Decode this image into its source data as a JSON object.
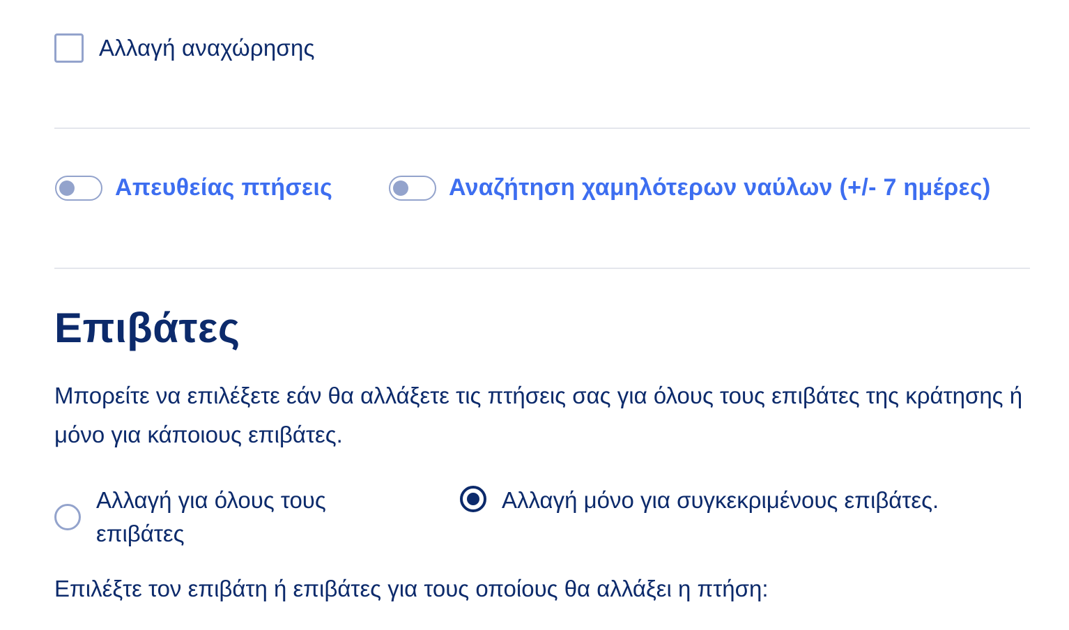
{
  "colors": {
    "primary": "#0c2a6b",
    "accent": "#3d6ef0",
    "muted": "#93a3cc",
    "divider": "#e4e6ec"
  },
  "departure_change": {
    "label": "Αλλαγή αναχώρησης",
    "checked": false
  },
  "toggles": [
    {
      "label": "Απευθείας πτήσεις",
      "on": false
    },
    {
      "label": "Αναζήτηση χαμηλότερων ναύλων (+/- 7 ημέρες)",
      "on": false
    }
  ],
  "passengers": {
    "title": "Επιβάτες",
    "description": "Μπορείτε να επιλέξετε εάν θα αλλάξετε τις πτήσεις σας για όλους τους επιβάτες της κράτησης ή μόνο για κάποιους επιβάτες.",
    "options": [
      {
        "label": "Αλλαγή για όλους τους επιβάτες",
        "selected": false
      },
      {
        "label": "Αλλαγή μόνο για συγκεκριμένους επιβάτες.",
        "selected": true
      }
    ],
    "select_prompt": "Επιλέξτε τον επιβάτη ή επιβάτες για τους οποίους θα αλλάξει η πτήση:"
  }
}
